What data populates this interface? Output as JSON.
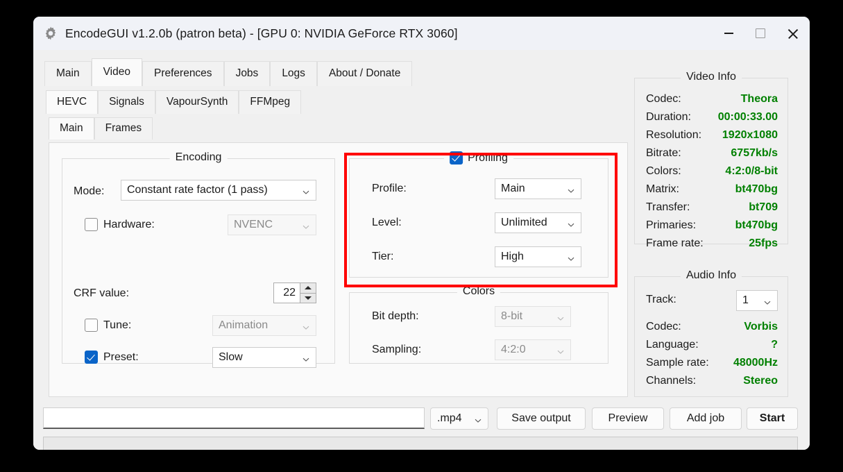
{
  "window": {
    "title": "EncodeGUI v1.2.0b (patron beta) - [GPU 0: NVIDIA GeForce RTX 3060]",
    "icon": "gear-icon",
    "controls": {
      "minimize": "minimize-icon",
      "maximize": "maximize-icon",
      "close": "close-icon"
    }
  },
  "tabs_level1": [
    {
      "label": "Main",
      "selected": false
    },
    {
      "label": "Video",
      "selected": true
    },
    {
      "label": "Preferences",
      "selected": false
    },
    {
      "label": "Jobs",
      "selected": false
    },
    {
      "label": "Logs",
      "selected": false
    },
    {
      "label": "About / Donate",
      "selected": false
    }
  ],
  "tabs_level2": [
    {
      "label": "HEVC",
      "selected": true
    },
    {
      "label": "Signals",
      "selected": false
    },
    {
      "label": "VapourSynth",
      "selected": false
    },
    {
      "label": "FFMpeg",
      "selected": false
    }
  ],
  "tabs_level3": [
    {
      "label": "Main",
      "selected": true
    },
    {
      "label": "Frames",
      "selected": false
    }
  ],
  "encoding_group": {
    "title": "Encoding",
    "mode_label": "Mode:",
    "mode_value": "Constant rate factor (1 pass)",
    "hardware_label": "Hardware:",
    "hardware_checked": false,
    "hardware_value": "NVENC",
    "hardware_enabled": false,
    "crf_label": "CRF value:",
    "crf_value": "22",
    "tune_label": "Tune:",
    "tune_checked": false,
    "tune_value": "Animation",
    "tune_enabled": false,
    "preset_label": "Preset:",
    "preset_checked": true,
    "preset_value": "Slow",
    "preset_enabled": true
  },
  "profiling_group": {
    "title": "Profiling",
    "checked": true,
    "highlighted": true,
    "highlight_color": "#ff0000",
    "profile_label": "Profile:",
    "profile_value": "Main",
    "level_label": "Level:",
    "level_value": "Unlimited",
    "tier_label": "Tier:",
    "tier_value": "High"
  },
  "colors_group": {
    "title": "Colors",
    "bitdepth_label": "Bit depth:",
    "bitdepth_value": "8-bit",
    "sampling_label": "Sampling:",
    "sampling_value": "4:2:0"
  },
  "video_info": {
    "title": "Video Info",
    "value_color": "#008000",
    "rows": [
      {
        "key": "Codec:",
        "value": "Theora"
      },
      {
        "key": "Duration:",
        "value": "00:00:33.00"
      },
      {
        "key": "Resolution:",
        "value": "1920x1080"
      },
      {
        "key": "Bitrate:",
        "value": "6757kb/s"
      },
      {
        "key": "Colors:",
        "value": "4:2:0/8-bit"
      },
      {
        "key": "Matrix:",
        "value": "bt470bg"
      },
      {
        "key": "Transfer:",
        "value": "bt709"
      },
      {
        "key": "Primaries:",
        "value": "bt470bg"
      },
      {
        "key": "Frame rate:",
        "value": "25fps"
      }
    ]
  },
  "audio_info": {
    "title": "Audio Info",
    "track_label": "Track:",
    "track_value": "1",
    "rows": [
      {
        "key": "Codec:",
        "value": "Vorbis"
      },
      {
        "key": "Language:",
        "value": "?"
      },
      {
        "key": "Sample rate:",
        "value": "48000Hz"
      },
      {
        "key": "Channels:",
        "value": "Stereo"
      }
    ]
  },
  "bottom_bar": {
    "path_value": "",
    "path_placeholder": "",
    "extension_value": ".mp4",
    "save_output_label": "Save output",
    "preview_label": "Preview",
    "add_job_label": "Add job",
    "start_label": "Start"
  }
}
